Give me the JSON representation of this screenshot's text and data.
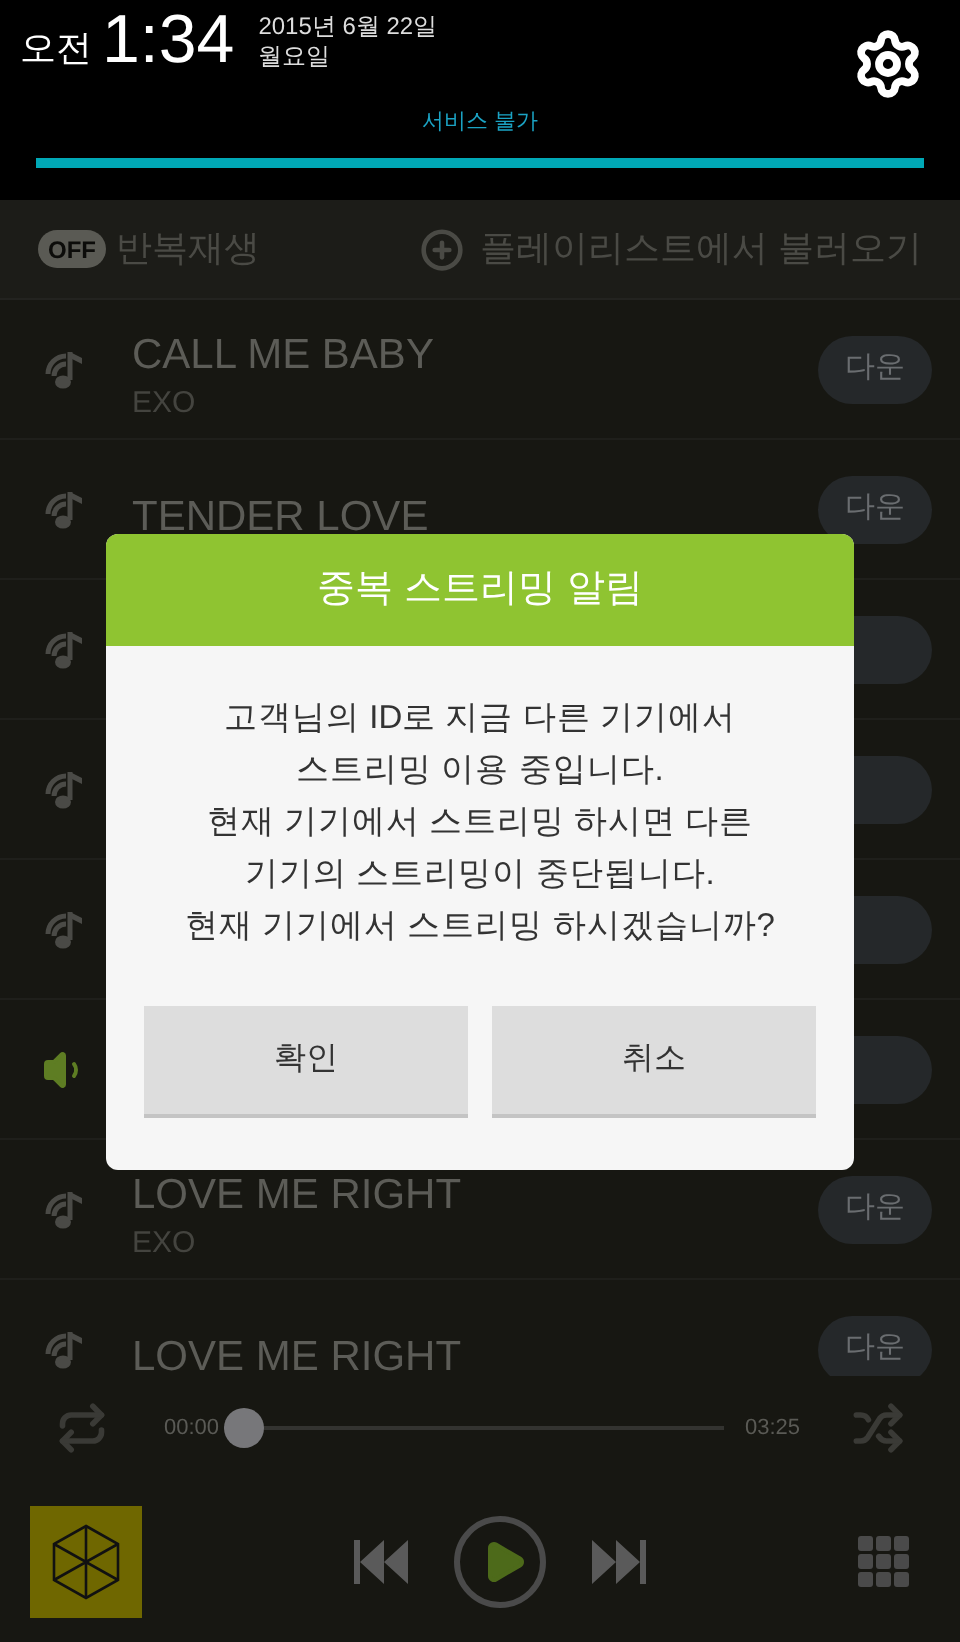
{
  "status": {
    "ampm": "오전",
    "time": "1:34",
    "date": "2015년 6월 22일",
    "weekday": "월요일",
    "service": "서비스 불가"
  },
  "toolbar": {
    "repeat_toggle": {
      "label": "OFF",
      "on": false
    },
    "repeat_label": "반복재생",
    "load_playlist": "플레이리스트에서 불러오기"
  },
  "songs": [
    {
      "title": "CALL ME BABY",
      "artist": "EXO",
      "playing": false,
      "button": "다운"
    },
    {
      "title": "TENDER LOVE",
      "playing": false,
      "button": "다운"
    },
    {
      "playing": false
    },
    {
      "playing": false
    },
    {
      "playing": false
    },
    {
      "playing": true
    },
    {
      "title": "LOVE ME RIGHT",
      "artist": "EXO",
      "playing": false,
      "button": "다운"
    },
    {
      "title": "LOVE ME RIGHT",
      "playing": false,
      "button": "다운"
    }
  ],
  "player": {
    "elapsed": "00:00",
    "total": "03:25",
    "progress": {
      "level": 0
    }
  },
  "dialog": {
    "title": "중복 스트리밍 알림",
    "message": [
      "고객님의 ID로 지금 다른 기기에서",
      "스트리밍 이용 중입니다.",
      "현재 기기에서 스트리밍 하시면 다른",
      "기기의 스트리밍이 중단됩니다.",
      "현재 기기에서 스트리밍 하시겠습니까?"
    ],
    "buttons": [
      "확인",
      "취소"
    ]
  }
}
